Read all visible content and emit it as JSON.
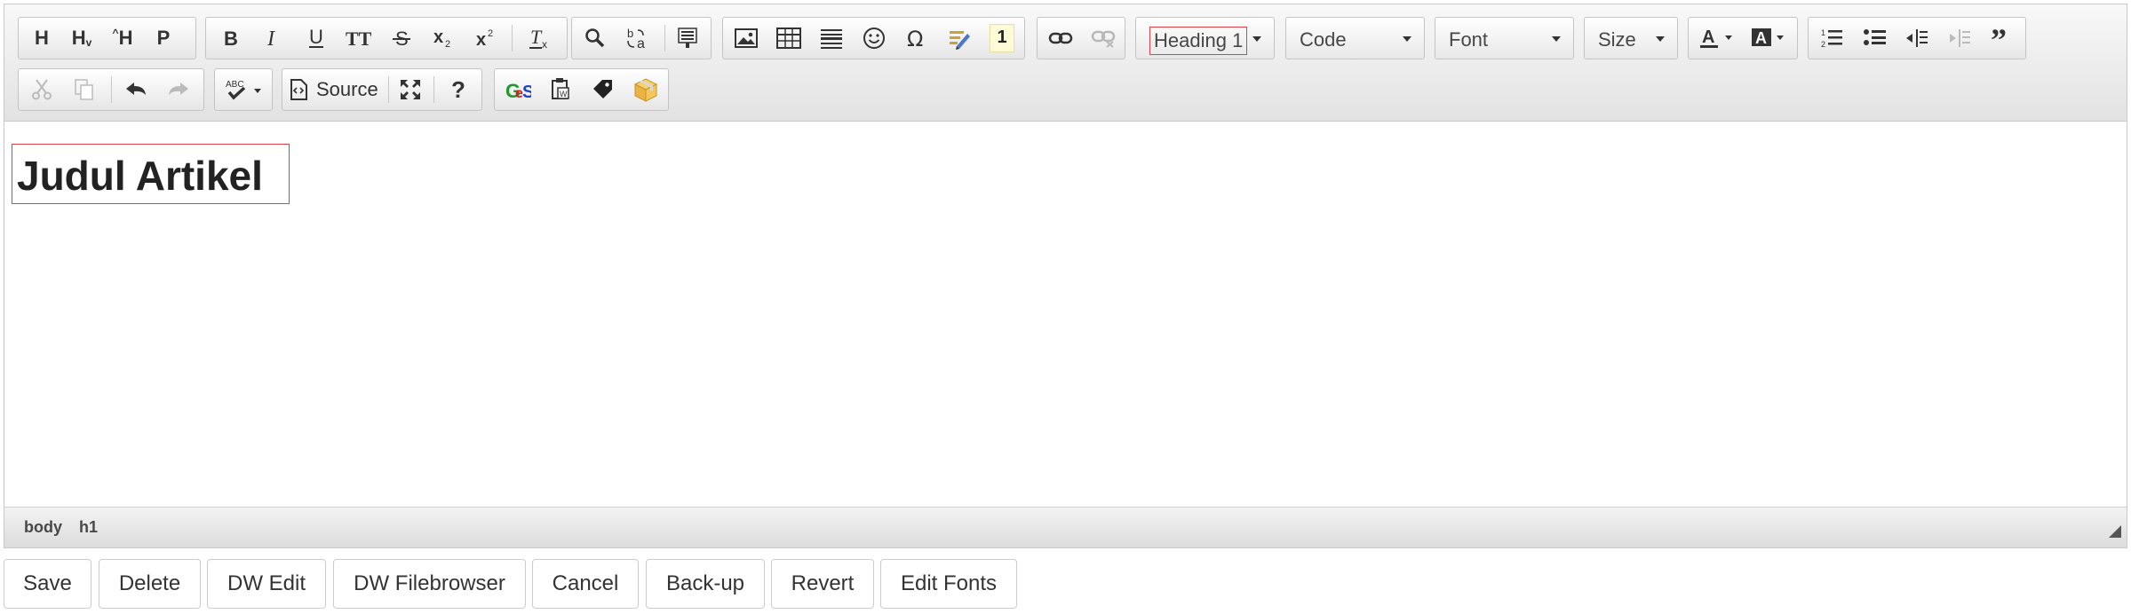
{
  "toolbar": {
    "format_combo": "Heading 1",
    "styles_combo": "Code",
    "font_combo": "Font",
    "size_combo": "Size",
    "source_label": "Source",
    "heading_buttons": [
      "H",
      "H",
      "H",
      "P"
    ],
    "help_label": "?",
    "num_badge": "1"
  },
  "content": {
    "heading": "Judul Artikel"
  },
  "statusbar": {
    "path": [
      "body",
      "h1"
    ]
  },
  "actions": [
    "Save",
    "Delete",
    "DW Edit",
    "DW Filebrowser",
    "Cancel",
    "Back-up",
    "Revert",
    "Edit Fonts"
  ],
  "colors": {
    "selection_border": "#e0404a"
  }
}
